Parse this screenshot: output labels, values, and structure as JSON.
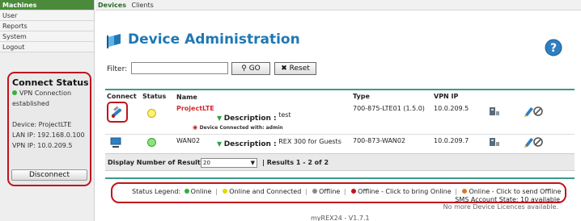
{
  "sidebar": {
    "items": [
      {
        "label": "Machines",
        "active": true
      },
      {
        "label": "User"
      },
      {
        "label": "Reports"
      },
      {
        "label": "System"
      },
      {
        "label": "Logout"
      }
    ],
    "connect_status": {
      "title": "Connect Status",
      "vpn_line1": "VPN Connection",
      "vpn_line2": "established",
      "device": "Device: ProjectLTE",
      "lan_ip": "LAN IP: 192.168.0.100",
      "vpn_ip": "VPN IP: 10.0.209.5",
      "disconnect_label": "Disconnect",
      "status_color": "#35b03a"
    }
  },
  "tabs": [
    {
      "label": "Devices",
      "active": true
    },
    {
      "label": "Clients"
    }
  ],
  "header": {
    "title": "Device Administration",
    "help_icon": "question-icon",
    "page_icon": "flag-icon"
  },
  "filter": {
    "label": "Filter:",
    "value": "",
    "go_label": "GO",
    "reset_label": "Reset"
  },
  "table": {
    "columns": {
      "connect": "Connect",
      "status": "Status",
      "name": "Name",
      "type": "Type",
      "vpn_ip": "VPN IP"
    },
    "rows": [
      {
        "name": "ProjectLTE",
        "description_label": "Description :",
        "description": "test",
        "connected_with": "Device Connected with: admin",
        "type": "700-875-LTE01 (1.5.0)",
        "vpn_ip": "10.0.209.5",
        "status": "online-connected",
        "status_color": "#fff07a"
      },
      {
        "name": "WAN02",
        "description_label": "Description :",
        "description": "REX 300 for Guests",
        "type": "700-873-WAN02",
        "vpn_ip": "10.0.209.7",
        "status": "online",
        "status_color": "#8ee27d"
      }
    ]
  },
  "results": {
    "label": "Display Number of Results",
    "per_page": "20",
    "summary": "Results 1 - 2 of 2"
  },
  "legend": {
    "title": "Status Legend:",
    "online": "Online",
    "online_connected": "Online and Connected",
    "offline": "Offline",
    "offline_bring_online": "Offline - Click to bring Online",
    "online_send_offline": "Online - Click to send Offline",
    "sms_state": "SMS Account State: 10 available",
    "colors": {
      "online": "#35b03a",
      "online_connected": "#e8d400",
      "offline": "#888888",
      "offline_bring_online": "#c0141c",
      "online_send_offline": "#d9772a"
    }
  },
  "notes": {
    "licences": "No more Device Licences available.",
    "version": "myREX24 - V1.7.1"
  }
}
